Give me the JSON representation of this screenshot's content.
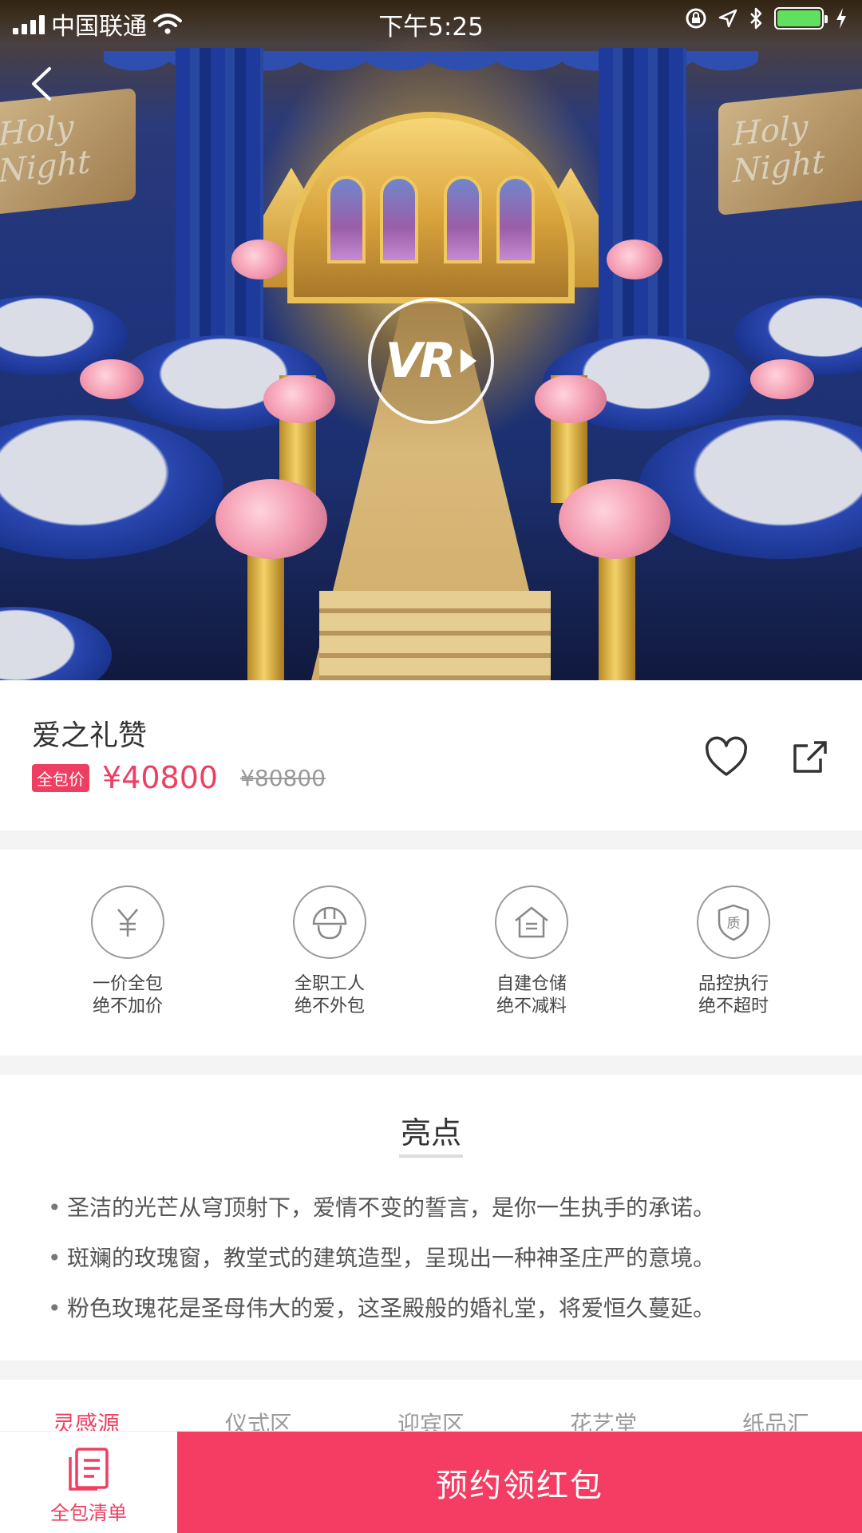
{
  "status_bar": {
    "carrier": "中国联通",
    "time": "下午5:25",
    "battery_color": "#5fe05f"
  },
  "hero": {
    "vr_label": "VR",
    "book_text_left": "Holy Night",
    "book_text_right": "Holy Night",
    "icons": {
      "back": "back-arrow-icon",
      "vr": "vr-play-icon"
    }
  },
  "product": {
    "title": "爱之礼赞",
    "price_tag": "全包价",
    "price": "¥40800",
    "original_price": "¥80800",
    "accent_color": "#ee3f62"
  },
  "features": [
    {
      "icon": "yuan-icon",
      "line1": "一价全包",
      "line2": "绝不加价"
    },
    {
      "icon": "helmet-icon",
      "line1": "全职工人",
      "line2": "绝不外包"
    },
    {
      "icon": "warehouse-icon",
      "line1": "自建仓储",
      "line2": "绝不减料"
    },
    {
      "icon": "quality-shield-icon",
      "line1": "品控执行",
      "line2": "绝不超时"
    }
  ],
  "highlights": {
    "title": "亮点",
    "items": [
      "圣洁的光芒从穹顶射下，爱情不变的誓言，是你一生执手的承诺。",
      "斑斓的玫瑰窗，教堂式的建筑造型，呈现出一种神圣庄严的意境。",
      "粉色玫瑰花是圣母伟大的爱，这圣殿般的婚礼堂，将爱恒久蔓延。"
    ]
  },
  "tabs": [
    {
      "label": "灵感源",
      "active": true
    },
    {
      "label": "仪式区",
      "active": false
    },
    {
      "label": "迎宾区",
      "active": false
    },
    {
      "label": "花艺堂",
      "active": false
    },
    {
      "label": "纸品汇",
      "active": false
    }
  ],
  "bottom_bar": {
    "list_label": "全包清单",
    "reserve_label": "预约领红包"
  }
}
